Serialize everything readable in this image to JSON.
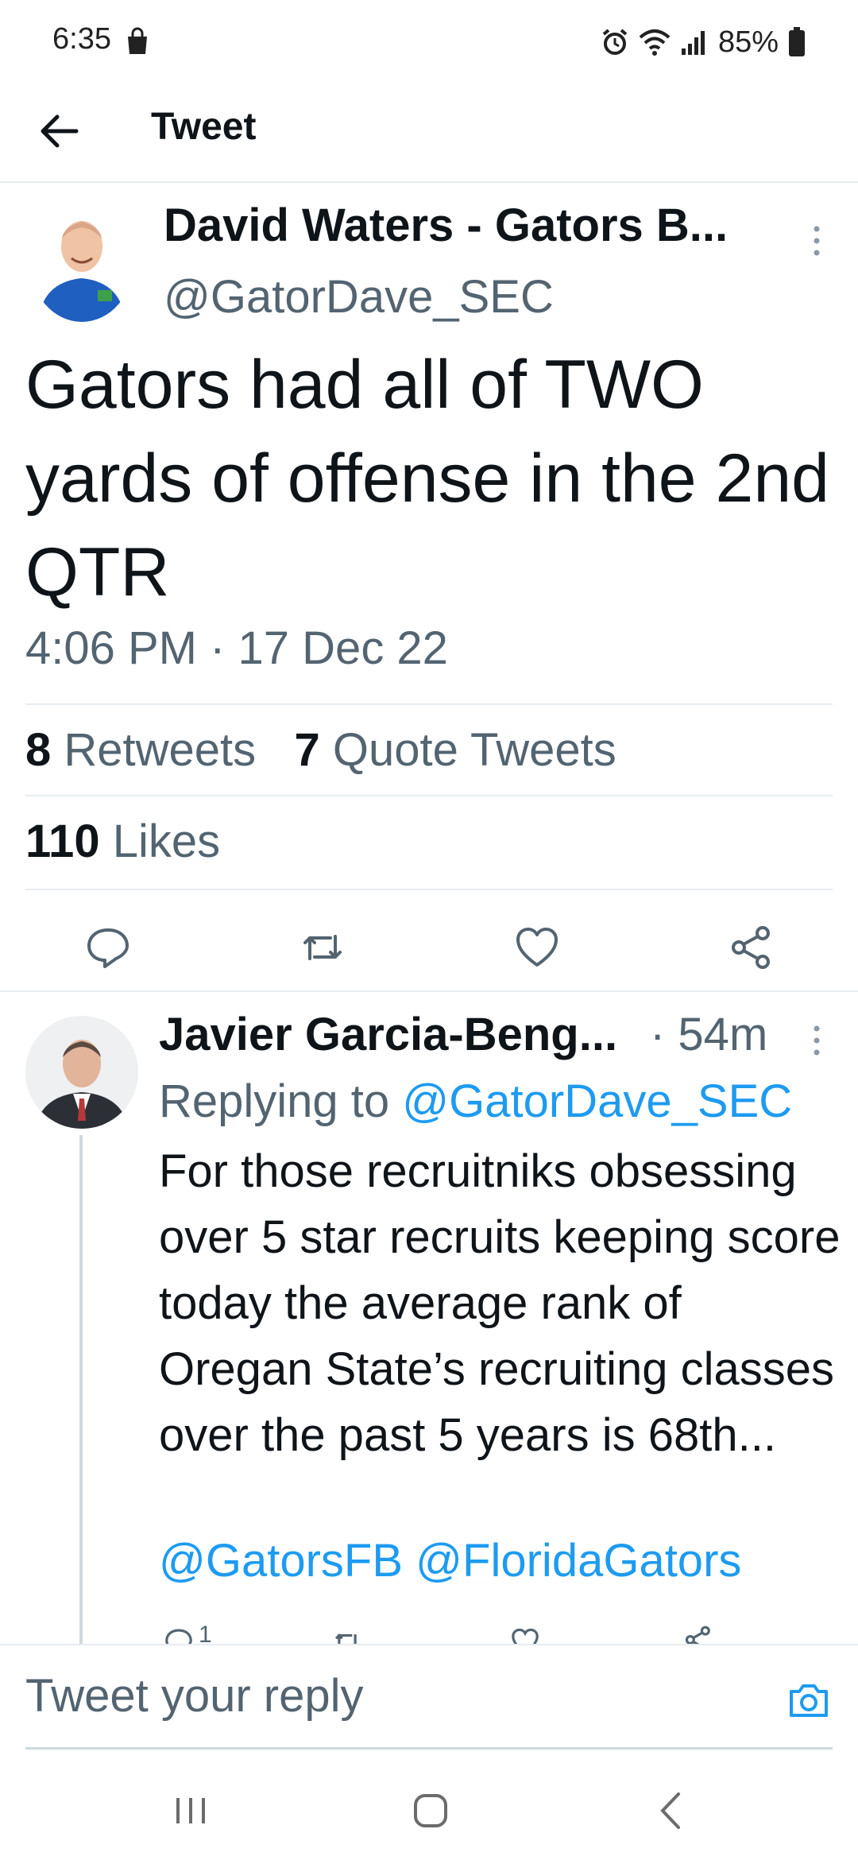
{
  "status_bar": {
    "time": "6:35",
    "battery": "85%"
  },
  "header": {
    "title": "Tweet"
  },
  "main_tweet": {
    "author_name": "David Waters - Gators B...",
    "handle": "@GatorDave_SEC",
    "text": "Gators had all of TWO yards of offense in the 2nd QTR",
    "timestamp": "4:06 PM · 17 Dec 22",
    "retweets_count": "8",
    "retweets_label": "Retweets",
    "quote_tweets_count": "7",
    "quote_tweets_label": "Quote Tweets",
    "likes_count": "110",
    "likes_label": "Likes"
  },
  "reply": {
    "author_name": "Javier Garcia-Beng...",
    "time": "· 54m",
    "replying_prefix": "Replying to",
    "replying_to": "@GatorDave_SEC",
    "text": "For those recruitniks obsessing over 5 star recruits keeping score today the average rank of Oregan State’s recruiting classes over the past 5 years is 68th...",
    "mentions": "@GatorsFB @FloridaGators",
    "reply_count": "1"
  },
  "compose": {
    "placeholder": "Tweet your reply"
  },
  "colors": {
    "accent": "#1d9bf0",
    "text": "#0f1419",
    "muted": "#536471",
    "divider": "#e6ecf0"
  },
  "icons": {
    "back": "arrow-left-icon",
    "more": "more-vertical-icon",
    "reply": "comment-icon",
    "retweet": "retweet-icon",
    "like": "heart-icon",
    "share": "share-icon",
    "camera": "camera-icon"
  }
}
